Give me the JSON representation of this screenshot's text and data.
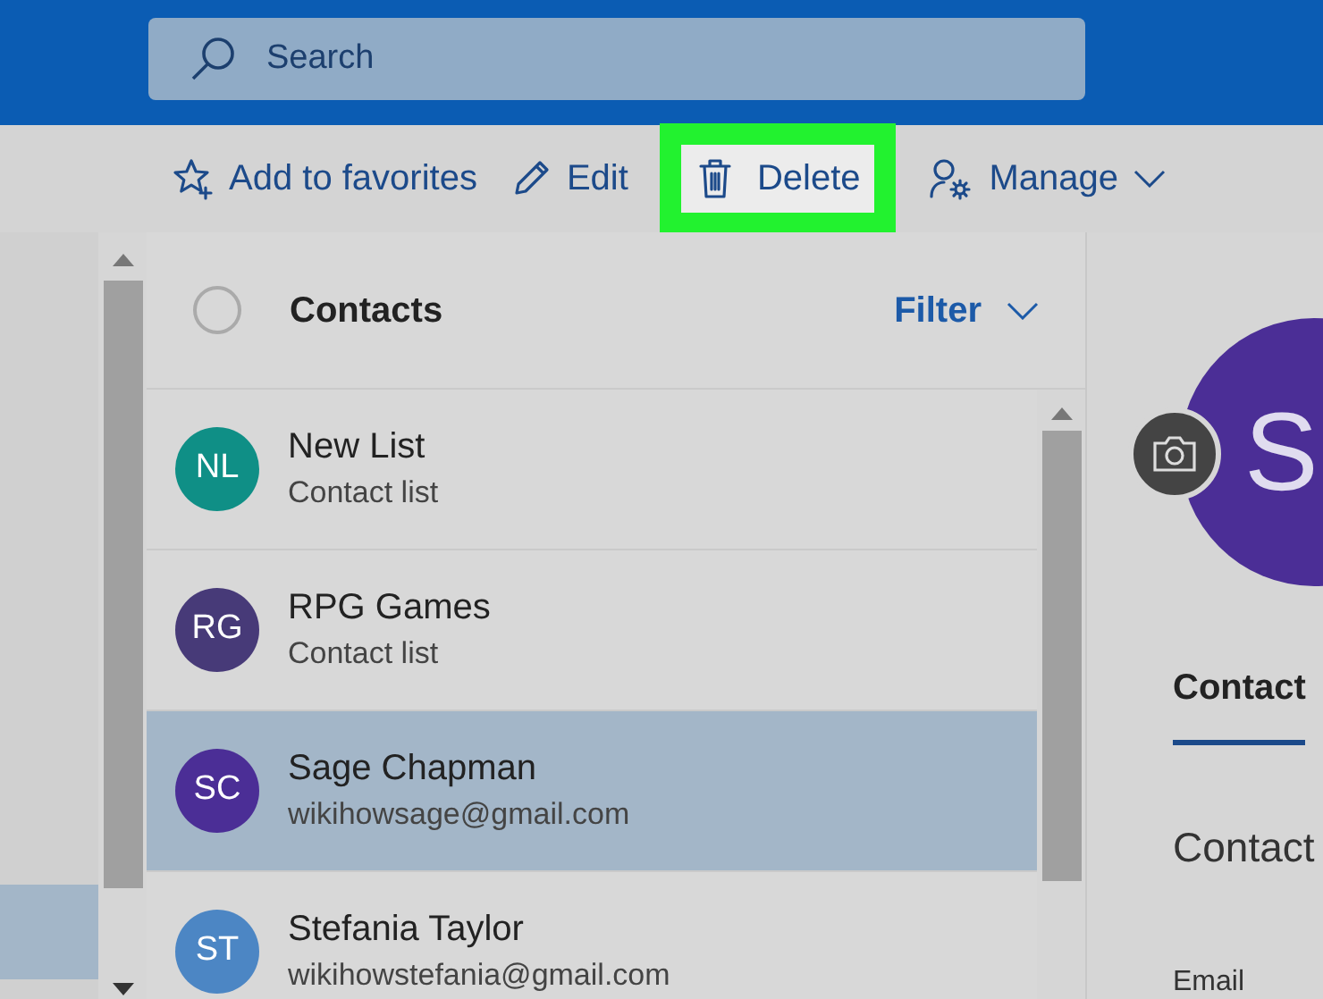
{
  "search": {
    "placeholder": "Search"
  },
  "toolbar": [
    {
      "kind": "star",
      "label": "Add to favorites",
      "highlighted": false,
      "dropdown": false
    },
    {
      "kind": "pencil",
      "label": "Edit",
      "highlighted": false,
      "dropdown": false
    },
    {
      "kind": "trash",
      "label": "Delete",
      "highlighted": true,
      "dropdown": false
    },
    {
      "kind": "manage",
      "label": "Manage",
      "highlighted": false,
      "dropdown": true
    }
  ],
  "list": {
    "title": "Contacts",
    "select_all_checked": false,
    "filter": "Filter",
    "rows": [
      {
        "initials": "NL",
        "name": "New List",
        "detail": "Contact list",
        "color": "#0f8f86",
        "selected": false
      },
      {
        "initials": "RG",
        "name": "RPG Games",
        "detail": "Contact list",
        "color": "#473a78",
        "selected": false
      },
      {
        "initials": "SC",
        "name": "Sage Chapman",
        "detail": "wikihowsage@gmail.com",
        "color": "#4b2e96",
        "selected": true
      },
      {
        "initials": "ST",
        "name": "Stefania Taylor",
        "detail": "wikihowstefania@gmail.com",
        "color": "#4c86c4",
        "selected": false
      }
    ]
  },
  "detail": {
    "avatar_initials": "S",
    "tabs": [
      {
        "label": "Contact",
        "selected": true
      }
    ],
    "heading": "Contact",
    "field_label": "Email"
  }
}
